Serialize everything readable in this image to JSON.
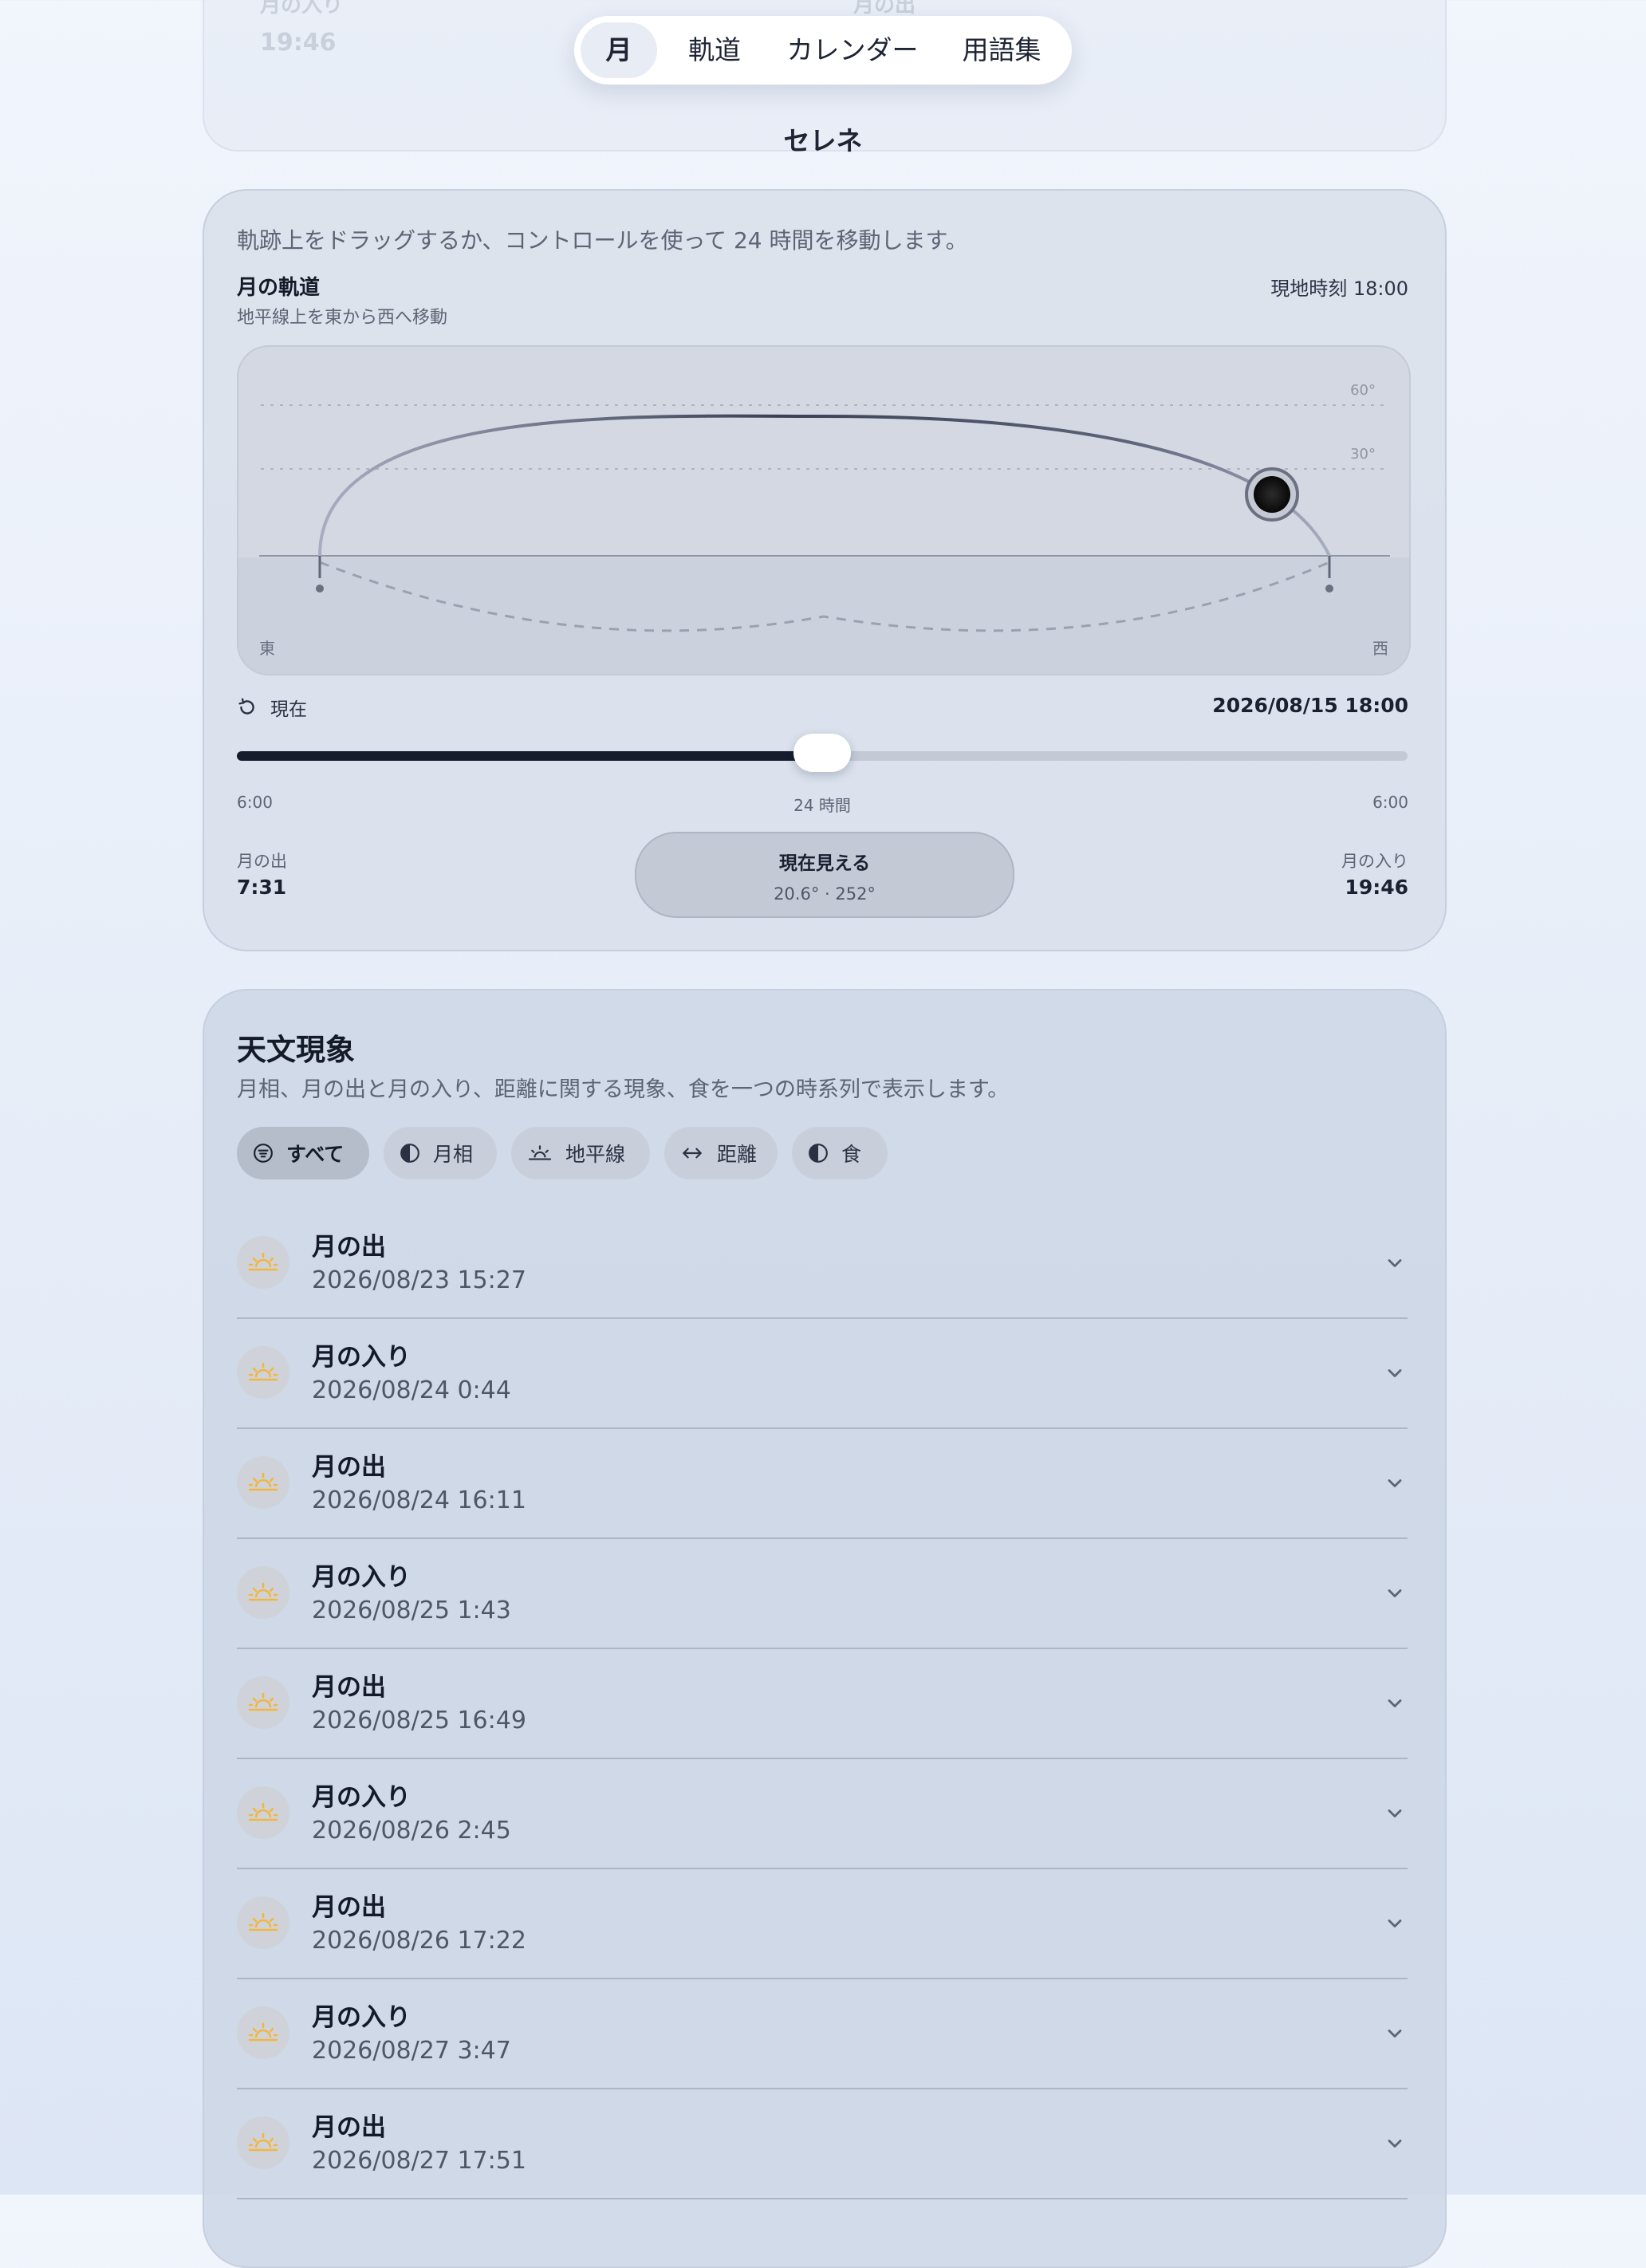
{
  "ghost": {
    "label": "月の入り",
    "time": "19:46",
    "right": "月の出"
  },
  "tabs": [
    {
      "label": "月",
      "active": true
    },
    {
      "label": "軌道",
      "active": false
    },
    {
      "label": "カレンダー",
      "active": false
    },
    {
      "label": "用語集",
      "active": false
    }
  ],
  "app_name": "セレネ",
  "track": {
    "hint": "軌跡上をドラッグするか、コントロールを使って 24 時間を移動します。",
    "title": "月の軌道",
    "subtitle": "地平線上を東から西へ移動",
    "local_time": "現地時刻 18:00",
    "plot": {
      "label_60": "60°",
      "label_30": "30°",
      "east": "東",
      "west": "西"
    },
    "reset_label": "現在",
    "datetime": "2026/08/15 18:00",
    "slider": {
      "start": "6:00",
      "middle": "24 時間",
      "end": "6:00",
      "value_fraction": 0.5
    },
    "moonrise": {
      "label": "月の出",
      "time": "7:31"
    },
    "moonset": {
      "label": "月の入り",
      "time": "19:46"
    },
    "visible": {
      "label": "現在見える",
      "detail": "20.6° · 252°"
    }
  },
  "events": {
    "title": "天文現象",
    "description": "月相、月の出と月の入り、距離に関する現象、食を一つの時系列で表示します。",
    "filters": [
      {
        "label": "すべて",
        "icon": "filter-icon",
        "active": true
      },
      {
        "label": "月相",
        "icon": "moon-phase-icon",
        "active": false
      },
      {
        "label": "地平線",
        "icon": "horizon-icon",
        "active": false
      },
      {
        "label": "距離",
        "icon": "distance-arrows-icon",
        "active": false
      },
      {
        "label": "食",
        "icon": "eclipse-icon",
        "active": false
      }
    ],
    "items": [
      {
        "title": "月の出",
        "date": "2026/08/23 15:27"
      },
      {
        "title": "月の入り",
        "date": "2026/08/24 0:44"
      },
      {
        "title": "月の出",
        "date": "2026/08/24 16:11"
      },
      {
        "title": "月の入り",
        "date": "2026/08/25 1:43"
      },
      {
        "title": "月の出",
        "date": "2026/08/25 16:49"
      },
      {
        "title": "月の入り",
        "date": "2026/08/26 2:45"
      },
      {
        "title": "月の出",
        "date": "2026/08/26 17:22"
      },
      {
        "title": "月の入り",
        "date": "2026/08/27 3:47"
      },
      {
        "title": "月の出",
        "date": "2026/08/27 17:51"
      }
    ],
    "icon_color": "#f2b640"
  }
}
